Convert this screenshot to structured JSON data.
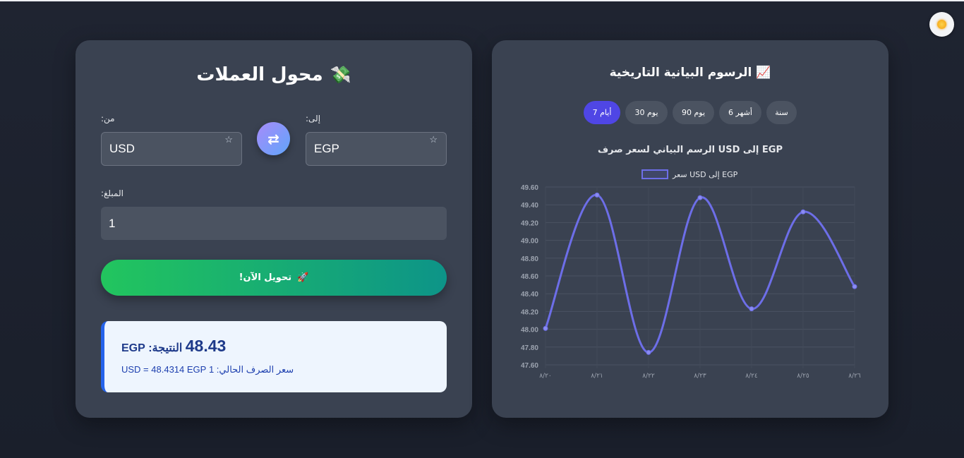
{
  "theme_toggle": {
    "icon": "sun-icon"
  },
  "converter": {
    "title": "محول العملات",
    "title_emoji": "💸",
    "from_label": ":من",
    "to_label": ":إلى",
    "from_value": "USD",
    "to_value": "EGP",
    "favorite_glyph": "☆",
    "swap_glyph": "⇄",
    "amount_label": ":المبلغ",
    "amount_value": "1",
    "convert_label": "!تحويل الآن",
    "convert_emoji": "🚀",
    "result_label": "النتيجة:",
    "result_value": "48.43",
    "result_currency": "EGP",
    "rate_text": "سعر الصرف الحالي: 1 USD = 48.4314 EGP"
  },
  "charts": {
    "title": "الرسوم البيانية التاريخية",
    "title_emoji": "📈",
    "periods": [
      "7 أيام",
      "30 يوم",
      "90 يوم",
      "6 أشهر",
      "سنة"
    ],
    "active_period": "7 أيام",
    "colors": {
      "accent": "#4f46e5",
      "line": "#6d6ee8"
    }
  },
  "chart_data": {
    "type": "line",
    "title": "الرسم البياني لسعر صرف USD إلى EGP",
    "categories": [
      "٨/٢٠",
      "٨/٢١",
      "٨/٢٢",
      "٨/٢٣",
      "٨/٢٤",
      "٨/٢٥",
      "٨/٢٦"
    ],
    "series": [
      {
        "name": "سعر USD إلى EGP",
        "values": [
          48.01,
          49.51,
          47.74,
          49.48,
          48.23,
          49.32,
          48.48
        ]
      }
    ],
    "ylim": [
      47.6,
      49.6
    ],
    "yticks": [
      "49.60",
      "49.40",
      "49.20",
      "49.00",
      "48.80",
      "48.60",
      "48.40",
      "48.20",
      "48.00",
      "47.80",
      "47.60"
    ],
    "grid": true,
    "legend": "top"
  }
}
